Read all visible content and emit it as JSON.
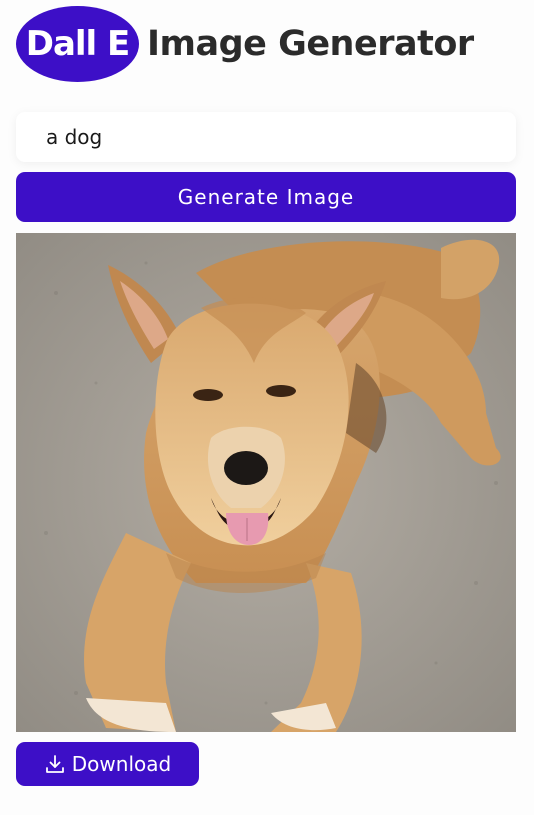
{
  "header": {
    "logo_text": "Dall E",
    "title": "Image Generator"
  },
  "prompt": {
    "value": "a dog"
  },
  "generate_button": {
    "label": "Generate Image"
  },
  "download_button": {
    "label": "Download",
    "icon": "download-icon"
  },
  "colors": {
    "accent": "#3d0fc7",
    "background": "#fdfdfd",
    "title_text": "#2b2b2b"
  }
}
